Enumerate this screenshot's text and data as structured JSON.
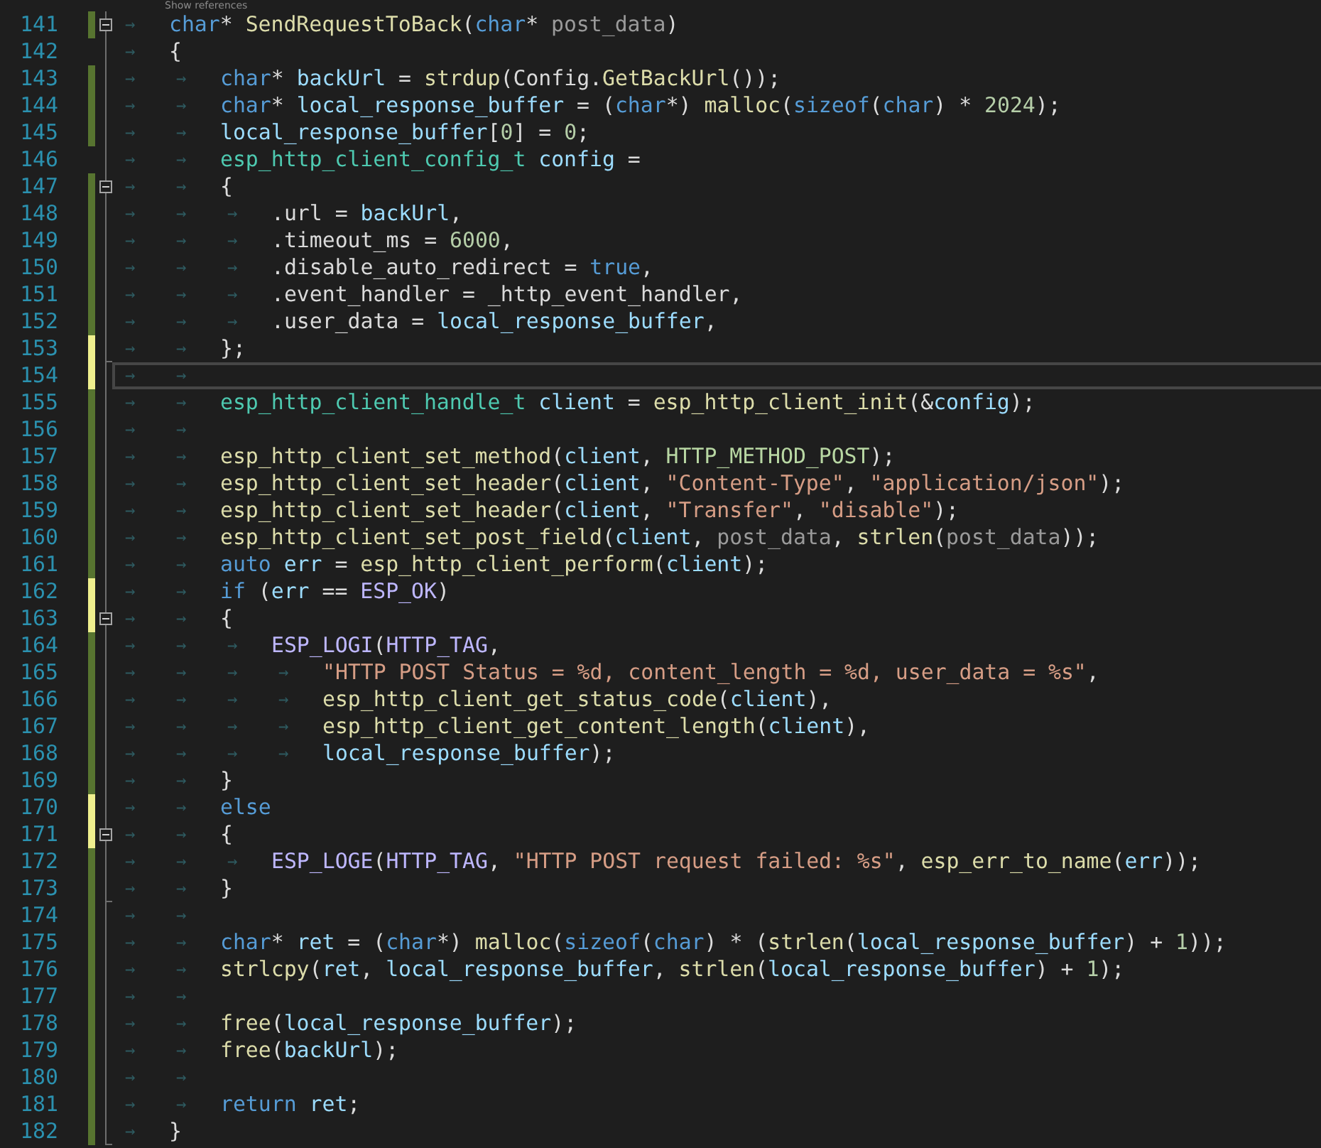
{
  "codelens": "Show references",
  "lines": [
    {
      "number": "141",
      "color": "#577430",
      "collapse_box": true,
      "fold_end": false,
      "current": false,
      "tabs": [
        "→"
      ],
      "code": [
        {
          "text": "char",
          "kind": "kw"
        },
        {
          "text": "* ",
          "kind": "punc"
        },
        {
          "text": "SendRequestToBack",
          "kind": "fn"
        },
        {
          "text": "(",
          "kind": "punc"
        },
        {
          "text": "char",
          "kind": "kw"
        },
        {
          "text": "* ",
          "kind": "punc"
        },
        {
          "text": "post_data",
          "kind": "param"
        },
        {
          "text": ")",
          "kind": "punc"
        }
      ]
    },
    {
      "number": "142",
      "collapse_box": false,
      "fold_end": false,
      "current": false,
      "tabs": [
        "→"
      ],
      "code": [
        {
          "text": "{",
          "kind": "punc"
        }
      ]
    },
    {
      "number": "143",
      "color": "#577430",
      "collapse_box": false,
      "fold_end": false,
      "current": false,
      "tabs": [
        "→",
        "→"
      ],
      "code": [
        {
          "text": "char",
          "kind": "kw"
        },
        {
          "text": "* ",
          "kind": "punc"
        },
        {
          "text": "backUrl",
          "kind": "var"
        },
        {
          "text": " = ",
          "kind": "punc"
        },
        {
          "text": "strdup",
          "kind": "fn"
        },
        {
          "text": "(",
          "kind": "punc"
        },
        {
          "text": "Config",
          "kind": "field"
        },
        {
          "text": ".",
          "kind": "punc"
        },
        {
          "text": "GetBackUrl",
          "kind": "fn"
        },
        {
          "text": "());",
          "kind": "punc"
        }
      ]
    },
    {
      "number": "144",
      "color": "#577430",
      "collapse_box": false,
      "fold_end": false,
      "current": false,
      "tabs": [
        "→",
        "→"
      ],
      "code": [
        {
          "text": "char",
          "kind": "kw"
        },
        {
          "text": "* ",
          "kind": "punc"
        },
        {
          "text": "local_response_buffer",
          "kind": "var"
        },
        {
          "text": " = (",
          "kind": "punc"
        },
        {
          "text": "char",
          "kind": "kw"
        },
        {
          "text": "*) ",
          "kind": "punc"
        },
        {
          "text": "malloc",
          "kind": "fn"
        },
        {
          "text": "(",
          "kind": "punc"
        },
        {
          "text": "sizeof",
          "kind": "kw"
        },
        {
          "text": "(",
          "kind": "punc"
        },
        {
          "text": "char",
          "kind": "kw"
        },
        {
          "text": ") * ",
          "kind": "punc"
        },
        {
          "text": "2024",
          "kind": "num"
        },
        {
          "text": ");",
          "kind": "punc"
        }
      ]
    },
    {
      "number": "145",
      "color": "#577430",
      "collapse_box": false,
      "fold_end": false,
      "current": false,
      "tabs": [
        "→",
        "→"
      ],
      "code": [
        {
          "text": "local_response_buffer",
          "kind": "var"
        },
        {
          "text": "[",
          "kind": "punc"
        },
        {
          "text": "0",
          "kind": "num"
        },
        {
          "text": "] = ",
          "kind": "punc"
        },
        {
          "text": "0",
          "kind": "num"
        },
        {
          "text": ";",
          "kind": "punc"
        }
      ]
    },
    {
      "number": "146",
      "collapse_box": false,
      "fold_end": false,
      "current": false,
      "tabs": [
        "→",
        "→"
      ],
      "code": [
        {
          "text": "esp_http_client_config_t ",
          "kind": "type"
        },
        {
          "text": "config",
          "kind": "var"
        },
        {
          "text": " =",
          "kind": "punc"
        }
      ]
    },
    {
      "number": "147",
      "color": "#577430",
      "collapse_box": true,
      "fold_end": false,
      "current": false,
      "tabs": [
        "→",
        "→"
      ],
      "code": [
        {
          "text": "{",
          "kind": "punc"
        }
      ]
    },
    {
      "number": "148",
      "color": "#577430",
      "collapse_box": false,
      "fold_end": false,
      "current": false,
      "tabs": [
        "→",
        "→",
        "→"
      ],
      "code": [
        {
          "text": ".",
          "kind": "punc"
        },
        {
          "text": "url",
          "kind": "field"
        },
        {
          "text": " = ",
          "kind": "punc"
        },
        {
          "text": "backUrl",
          "kind": "var"
        },
        {
          "text": ",",
          "kind": "punc"
        }
      ]
    },
    {
      "number": "149",
      "color": "#577430",
      "collapse_box": false,
      "fold_end": false,
      "current": false,
      "tabs": [
        "→",
        "→",
        "→"
      ],
      "code": [
        {
          "text": ".",
          "kind": "punc"
        },
        {
          "text": "timeout_ms",
          "kind": "field"
        },
        {
          "text": " = ",
          "kind": "punc"
        },
        {
          "text": "6000",
          "kind": "num"
        },
        {
          "text": ",",
          "kind": "punc"
        }
      ]
    },
    {
      "number": "150",
      "color": "#577430",
      "collapse_box": false,
      "fold_end": false,
      "current": false,
      "tabs": [
        "→",
        "→",
        "→"
      ],
      "code": [
        {
          "text": ".",
          "kind": "punc"
        },
        {
          "text": "disable_auto_redirect",
          "kind": "field"
        },
        {
          "text": " = ",
          "kind": "punc"
        },
        {
          "text": "true",
          "kind": "kw"
        },
        {
          "text": ",",
          "kind": "punc"
        }
      ]
    },
    {
      "number": "151",
      "color": "#577430",
      "collapse_box": false,
      "fold_end": false,
      "current": false,
      "tabs": [
        "→",
        "→",
        "→"
      ],
      "code": [
        {
          "text": ".",
          "kind": "punc"
        },
        {
          "text": "event_handler",
          "kind": "field"
        },
        {
          "text": " = ",
          "kind": "punc"
        },
        {
          "text": "_http_event_handler",
          "kind": "field"
        },
        {
          "text": ",",
          "kind": "punc"
        }
      ]
    },
    {
      "number": "152",
      "color": "#577430",
      "collapse_box": false,
      "fold_end": false,
      "current": false,
      "tabs": [
        "→",
        "→",
        "→"
      ],
      "code": [
        {
          "text": ".",
          "kind": "punc"
        },
        {
          "text": "user_data",
          "kind": "field"
        },
        {
          "text": " = ",
          "kind": "punc"
        },
        {
          "text": "local_response_buffer",
          "kind": "var"
        },
        {
          "text": ",",
          "kind": "punc"
        }
      ]
    },
    {
      "number": "153",
      "color": "#efef8e",
      "collapse_box": false,
      "fold_end": true,
      "current": false,
      "tabs": [
        "→",
        "→"
      ],
      "code": [
        {
          "text": "};",
          "kind": "punc"
        }
      ]
    },
    {
      "number": "154",
      "color": "#efef8e",
      "collapse_box": false,
      "fold_end": false,
      "current": true,
      "tabs": [
        "→",
        "→"
      ]
    },
    {
      "number": "155",
      "color": "#577430",
      "collapse_box": false,
      "fold_end": false,
      "current": false,
      "tabs": [
        "→",
        "→"
      ],
      "code": [
        {
          "text": "esp_http_client_handle_t ",
          "kind": "type"
        },
        {
          "text": "client",
          "kind": "var"
        },
        {
          "text": " = ",
          "kind": "punc"
        },
        {
          "text": "esp_http_client_init",
          "kind": "fn"
        },
        {
          "text": "(&",
          "kind": "punc"
        },
        {
          "text": "config",
          "kind": "var"
        },
        {
          "text": ");",
          "kind": "punc"
        }
      ]
    },
    {
      "number": "156",
      "color": "#577430",
      "collapse_box": false,
      "fold_end": false,
      "current": false,
      "tabs": [
        "→",
        "→"
      ]
    },
    {
      "number": "157",
      "color": "#577430",
      "collapse_box": false,
      "fold_end": false,
      "current": false,
      "tabs": [
        "→",
        "→"
      ],
      "code": [
        {
          "text": "esp_http_client_set_method",
          "kind": "fn"
        },
        {
          "text": "(",
          "kind": "punc"
        },
        {
          "text": "client",
          "kind": "var"
        },
        {
          "text": ", ",
          "kind": "punc"
        },
        {
          "text": "HTTP_METHOD_POST",
          "kind": "enum"
        },
        {
          "text": ");",
          "kind": "punc"
        }
      ]
    },
    {
      "number": "158",
      "color": "#577430",
      "collapse_box": false,
      "fold_end": false,
      "current": false,
      "tabs": [
        "→",
        "→"
      ],
      "code": [
        {
          "text": "esp_http_client_set_header",
          "kind": "fn"
        },
        {
          "text": "(",
          "kind": "punc"
        },
        {
          "text": "client",
          "kind": "var"
        },
        {
          "text": ", ",
          "kind": "punc"
        },
        {
          "text": "\"Content-Type\"",
          "kind": "str"
        },
        {
          "text": ", ",
          "kind": "punc"
        },
        {
          "text": "\"application/json\"",
          "kind": "str"
        },
        {
          "text": ");",
          "kind": "punc"
        }
      ]
    },
    {
      "number": "159",
      "color": "#577430",
      "collapse_box": false,
      "fold_end": false,
      "current": false,
      "tabs": [
        "→",
        "→"
      ],
      "code": [
        {
          "text": "esp_http_client_set_header",
          "kind": "fn"
        },
        {
          "text": "(",
          "kind": "punc"
        },
        {
          "text": "client",
          "kind": "var"
        },
        {
          "text": ", ",
          "kind": "punc"
        },
        {
          "text": "\"Transfer\"",
          "kind": "str"
        },
        {
          "text": ", ",
          "kind": "punc"
        },
        {
          "text": "\"disable\"",
          "kind": "str"
        },
        {
          "text": ");",
          "kind": "punc"
        }
      ]
    },
    {
      "number": "160",
      "color": "#577430",
      "collapse_box": false,
      "fold_end": false,
      "current": false,
      "tabs": [
        "→",
        "→"
      ],
      "code": [
        {
          "text": "esp_http_client_set_post_field",
          "kind": "fn"
        },
        {
          "text": "(",
          "kind": "punc"
        },
        {
          "text": "client",
          "kind": "var"
        },
        {
          "text": ", ",
          "kind": "punc"
        },
        {
          "text": "post_data",
          "kind": "param"
        },
        {
          "text": ", ",
          "kind": "punc"
        },
        {
          "text": "strlen",
          "kind": "fn"
        },
        {
          "text": "(",
          "kind": "punc"
        },
        {
          "text": "post_data",
          "kind": "param"
        },
        {
          "text": "));",
          "kind": "punc"
        }
      ]
    },
    {
      "number": "161",
      "color": "#577430",
      "collapse_box": false,
      "fold_end": false,
      "current": false,
      "tabs": [
        "→",
        "→"
      ],
      "code": [
        {
          "text": "auto ",
          "kind": "kw"
        },
        {
          "text": "err",
          "kind": "var"
        },
        {
          "text": " = ",
          "kind": "punc"
        },
        {
          "text": "esp_http_client_perform",
          "kind": "fn"
        },
        {
          "text": "(",
          "kind": "punc"
        },
        {
          "text": "client",
          "kind": "var"
        },
        {
          "text": ");",
          "kind": "punc"
        }
      ]
    },
    {
      "number": "162",
      "color": "#efef8e",
      "collapse_box": false,
      "fold_end": false,
      "current": false,
      "tabs": [
        "→",
        "→"
      ],
      "code": [
        {
          "text": "if",
          "kind": "kw"
        },
        {
          "text": " (",
          "kind": "punc"
        },
        {
          "text": "err",
          "kind": "var"
        },
        {
          "text": " == ",
          "kind": "punc"
        },
        {
          "text": "ESP_OK",
          "kind": "macro"
        },
        {
          "text": ")",
          "kind": "punc"
        }
      ]
    },
    {
      "number": "163",
      "color": "#efef8e",
      "collapse_box": true,
      "fold_end": false,
      "current": false,
      "tabs": [
        "→",
        "→"
      ],
      "code": [
        {
          "text": "{",
          "kind": "punc"
        }
      ]
    },
    {
      "number": "164",
      "color": "#577430",
      "collapse_box": false,
      "fold_end": false,
      "current": false,
      "tabs": [
        "→",
        "→",
        "→"
      ],
      "code": [
        {
          "text": "ESP_LOGI",
          "kind": "macro"
        },
        {
          "text": "(",
          "kind": "punc"
        },
        {
          "text": "HTTP_TAG",
          "kind": "macro"
        },
        {
          "text": ",",
          "kind": "punc"
        }
      ]
    },
    {
      "number": "165",
      "color": "#577430",
      "collapse_box": false,
      "fold_end": false,
      "current": false,
      "tabs": [
        "→",
        "→",
        "→",
        "→"
      ],
      "code": [
        {
          "text": "\"HTTP POST Status = %d, content_length = %d, user_data = %s\"",
          "kind": "str"
        },
        {
          "text": ",",
          "kind": "punc"
        }
      ]
    },
    {
      "number": "166",
      "color": "#577430",
      "collapse_box": false,
      "fold_end": false,
      "current": false,
      "tabs": [
        "→",
        "→",
        "→",
        "→"
      ],
      "code": [
        {
          "text": "esp_http_client_get_status_code",
          "kind": "fn"
        },
        {
          "text": "(",
          "kind": "punc"
        },
        {
          "text": "client",
          "kind": "var"
        },
        {
          "text": "),",
          "kind": "punc"
        }
      ]
    },
    {
      "number": "167",
      "color": "#577430",
      "collapse_box": false,
      "fold_end": false,
      "current": false,
      "tabs": [
        "→",
        "→",
        "→",
        "→"
      ],
      "code": [
        {
          "text": "esp_http_client_get_content_length",
          "kind": "fn"
        },
        {
          "text": "(",
          "kind": "punc"
        },
        {
          "text": "client",
          "kind": "var"
        },
        {
          "text": "),",
          "kind": "punc"
        }
      ]
    },
    {
      "number": "168",
      "color": "#577430",
      "collapse_box": false,
      "fold_end": false,
      "current": false,
      "tabs": [
        "→",
        "→",
        "→",
        "→"
      ],
      "code": [
        {
          "text": "local_response_buffer",
          "kind": "var"
        },
        {
          "text": ");",
          "kind": "punc"
        }
      ]
    },
    {
      "number": "169",
      "color": "#577430",
      "collapse_box": false,
      "fold_end": false,
      "current": false,
      "tabs": [
        "→",
        "→"
      ],
      "code": [
        {
          "text": "}",
          "kind": "punc"
        }
      ]
    },
    {
      "number": "170",
      "color": "#efef8e",
      "collapse_box": false,
      "fold_end": false,
      "current": false,
      "tabs": [
        "→",
        "→"
      ],
      "code": [
        {
          "text": "else",
          "kind": "kw"
        }
      ]
    },
    {
      "number": "171",
      "color": "#efef8e",
      "collapse_box": true,
      "fold_end": false,
      "current": false,
      "tabs": [
        "→",
        "→"
      ],
      "code": [
        {
          "text": "{",
          "kind": "punc"
        }
      ]
    },
    {
      "number": "172",
      "color": "#577430",
      "collapse_box": false,
      "fold_end": false,
      "current": false,
      "tabs": [
        "→",
        "→",
        "→"
      ],
      "code": [
        {
          "text": "ESP_LOGE",
          "kind": "macro"
        },
        {
          "text": "(",
          "kind": "punc"
        },
        {
          "text": "HTTP_TAG",
          "kind": "macro"
        },
        {
          "text": ", ",
          "kind": "punc"
        },
        {
          "text": "\"HTTP POST request failed: %s\"",
          "kind": "str"
        },
        {
          "text": ", ",
          "kind": "punc"
        },
        {
          "text": "esp_err_to_name",
          "kind": "fn"
        },
        {
          "text": "(",
          "kind": "punc"
        },
        {
          "text": "err",
          "kind": "var"
        },
        {
          "text": "));",
          "kind": "punc"
        }
      ]
    },
    {
      "number": "173",
      "color": "#577430",
      "collapse_box": false,
      "fold_end": true,
      "current": false,
      "tabs": [
        "→",
        "→"
      ],
      "code": [
        {
          "text": "}",
          "kind": "punc"
        }
      ]
    },
    {
      "number": "174",
      "color": "#577430",
      "collapse_box": false,
      "fold_end": false,
      "current": false,
      "tabs": [
        "→",
        "→"
      ]
    },
    {
      "number": "175",
      "color": "#577430",
      "collapse_box": false,
      "fold_end": false,
      "current": false,
      "tabs": [
        "→",
        "→"
      ],
      "code": [
        {
          "text": "char",
          "kind": "kw"
        },
        {
          "text": "* ",
          "kind": "punc"
        },
        {
          "text": "ret",
          "kind": "var"
        },
        {
          "text": " = (",
          "kind": "punc"
        },
        {
          "text": "char",
          "kind": "kw"
        },
        {
          "text": "*) ",
          "kind": "punc"
        },
        {
          "text": "malloc",
          "kind": "fn"
        },
        {
          "text": "(",
          "kind": "punc"
        },
        {
          "text": "sizeof",
          "kind": "kw"
        },
        {
          "text": "(",
          "kind": "punc"
        },
        {
          "text": "char",
          "kind": "kw"
        },
        {
          "text": ") * (",
          "kind": "punc"
        },
        {
          "text": "strlen",
          "kind": "fn"
        },
        {
          "text": "(",
          "kind": "punc"
        },
        {
          "text": "local_response_buffer",
          "kind": "var"
        },
        {
          "text": ") + ",
          "kind": "punc"
        },
        {
          "text": "1",
          "kind": "num"
        },
        {
          "text": "));",
          "kind": "punc"
        }
      ]
    },
    {
      "number": "176",
      "color": "#577430",
      "collapse_box": false,
      "fold_end": false,
      "current": false,
      "tabs": [
        "→",
        "→"
      ],
      "code": [
        {
          "text": "strlcpy",
          "kind": "fn"
        },
        {
          "text": "(",
          "kind": "punc"
        },
        {
          "text": "ret",
          "kind": "var"
        },
        {
          "text": ", ",
          "kind": "punc"
        },
        {
          "text": "local_response_buffer",
          "kind": "var"
        },
        {
          "text": ", ",
          "kind": "punc"
        },
        {
          "text": "strlen",
          "kind": "fn"
        },
        {
          "text": "(",
          "kind": "punc"
        },
        {
          "text": "local_response_buffer",
          "kind": "var"
        },
        {
          "text": ") + ",
          "kind": "punc"
        },
        {
          "text": "1",
          "kind": "num"
        },
        {
          "text": ");",
          "kind": "punc"
        }
      ]
    },
    {
      "number": "177",
      "color": "#577430",
      "collapse_box": false,
      "fold_end": false,
      "current": false,
      "tabs": [
        "→",
        "→"
      ]
    },
    {
      "number": "178",
      "color": "#577430",
      "collapse_box": false,
      "fold_end": false,
      "current": false,
      "tabs": [
        "→",
        "→"
      ],
      "code": [
        {
          "text": "free",
          "kind": "fn"
        },
        {
          "text": "(",
          "kind": "punc"
        },
        {
          "text": "local_response_buffer",
          "kind": "var"
        },
        {
          "text": ");",
          "kind": "punc"
        }
      ]
    },
    {
      "number": "179",
      "color": "#577430",
      "collapse_box": false,
      "fold_end": false,
      "current": false,
      "tabs": [
        "→",
        "→"
      ],
      "code": [
        {
          "text": "free",
          "kind": "fn"
        },
        {
          "text": "(",
          "kind": "punc"
        },
        {
          "text": "backUrl",
          "kind": "var"
        },
        {
          "text": ");",
          "kind": "punc"
        }
      ]
    },
    {
      "number": "180",
      "color": "#577430",
      "collapse_box": false,
      "fold_end": false,
      "current": false,
      "tabs": [
        "→",
        "→"
      ]
    },
    {
      "number": "181",
      "color": "#577430",
      "collapse_box": false,
      "fold_end": false,
      "current": false,
      "tabs": [
        "→",
        "→"
      ],
      "code": [
        {
          "text": "return ",
          "kind": "kw"
        },
        {
          "text": "ret",
          "kind": "var"
        },
        {
          "text": ";",
          "kind": "punc"
        }
      ]
    },
    {
      "number": "182",
      "color": "#577430",
      "collapse_box": false,
      "fold_end": true,
      "current": false,
      "tabs": [
        "→"
      ],
      "code": [
        {
          "text": "}",
          "kind": "punc"
        }
      ]
    }
  ]
}
